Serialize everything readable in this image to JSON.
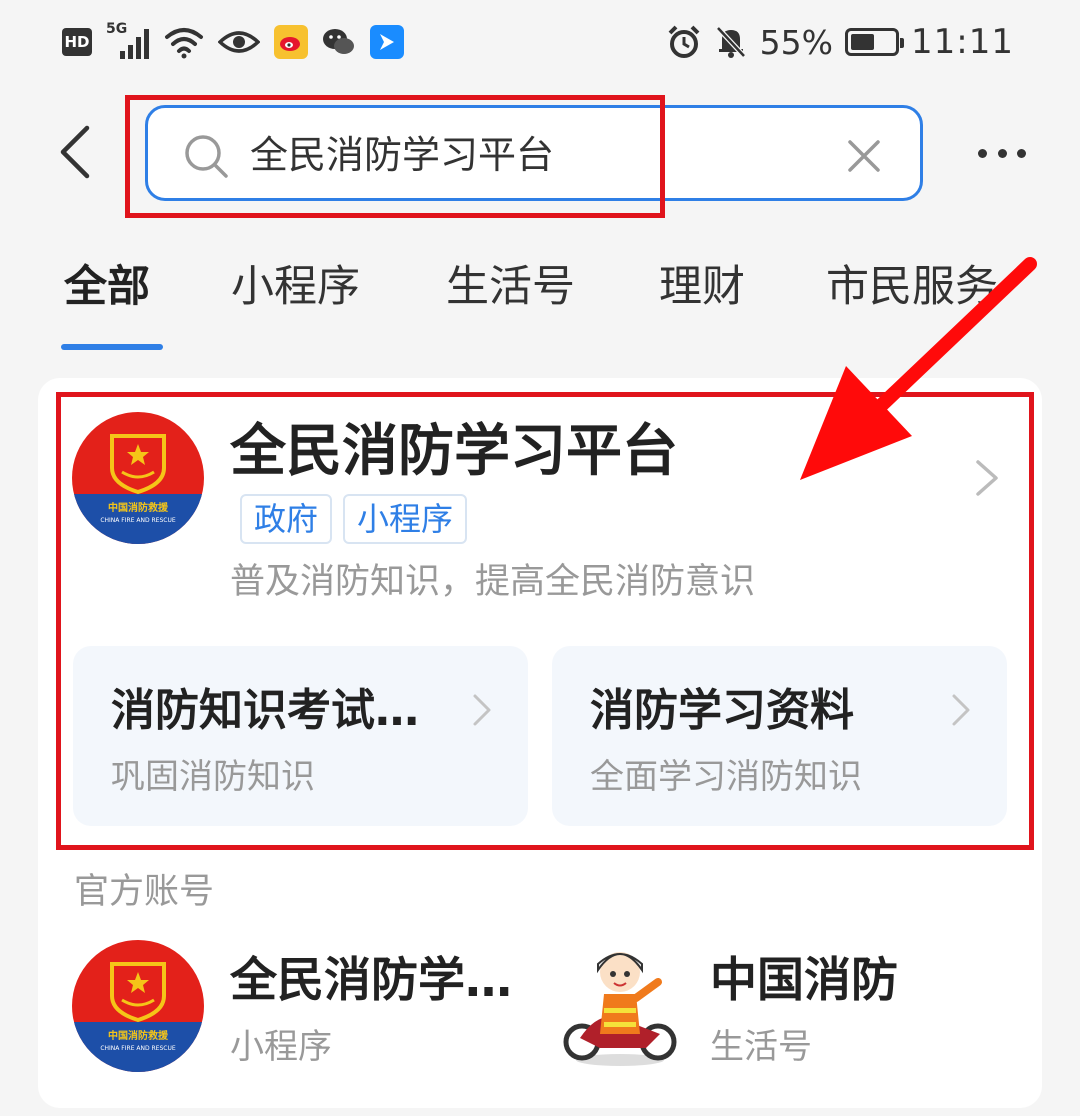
{
  "status_bar": {
    "hd_label": "HD",
    "network_label": "5G",
    "battery_text": "55%",
    "battery_level": 0.55,
    "time": "11:11",
    "icons": [
      "hd-icon",
      "signal-5g-icon",
      "wifi-icon",
      "eye-icon",
      "weibo-icon",
      "wechat-icon",
      "blue-app-icon",
      "alarm-icon",
      "mute-icon",
      "battery-icon"
    ]
  },
  "search": {
    "query": "全民消防学习平台",
    "back_icon": "chevron-left-icon",
    "clear_icon": "close-icon",
    "more_icon": "more-dots-icon"
  },
  "tabs": [
    {
      "label": "全部",
      "active": true
    },
    {
      "label": "小程序",
      "active": false
    },
    {
      "label": "生活号",
      "active": false
    },
    {
      "label": "理财",
      "active": false
    },
    {
      "label": "市民服务",
      "active": false
    }
  ],
  "main_result": {
    "title": "全民消防学习平台",
    "tags": [
      "政府",
      "小程序"
    ],
    "description": "普及消防知识，提高全民消防意识",
    "logo": {
      "text_cn": "中国消防救援",
      "text_en": "CHINA FIRE AND RESCUE",
      "colors": {
        "top": "#e3211a",
        "bottom": "#1d4fa8",
        "emblem": "#f5c518"
      }
    },
    "sub_entries": [
      {
        "title": "消防知识考试…",
        "desc": "巩固消防知识"
      },
      {
        "title": "消防学习资料",
        "desc": "全面学习消防知识"
      }
    ]
  },
  "official_accounts": {
    "label": "官方账号",
    "items": [
      {
        "name": "全民消防学…",
        "type": "小程序"
      },
      {
        "name": "中国消防",
        "type": "生活号"
      }
    ]
  },
  "colors": {
    "accent": "#2f7fe6",
    "highlight_red": "#e0141c",
    "background": "#f5f5f5"
  }
}
